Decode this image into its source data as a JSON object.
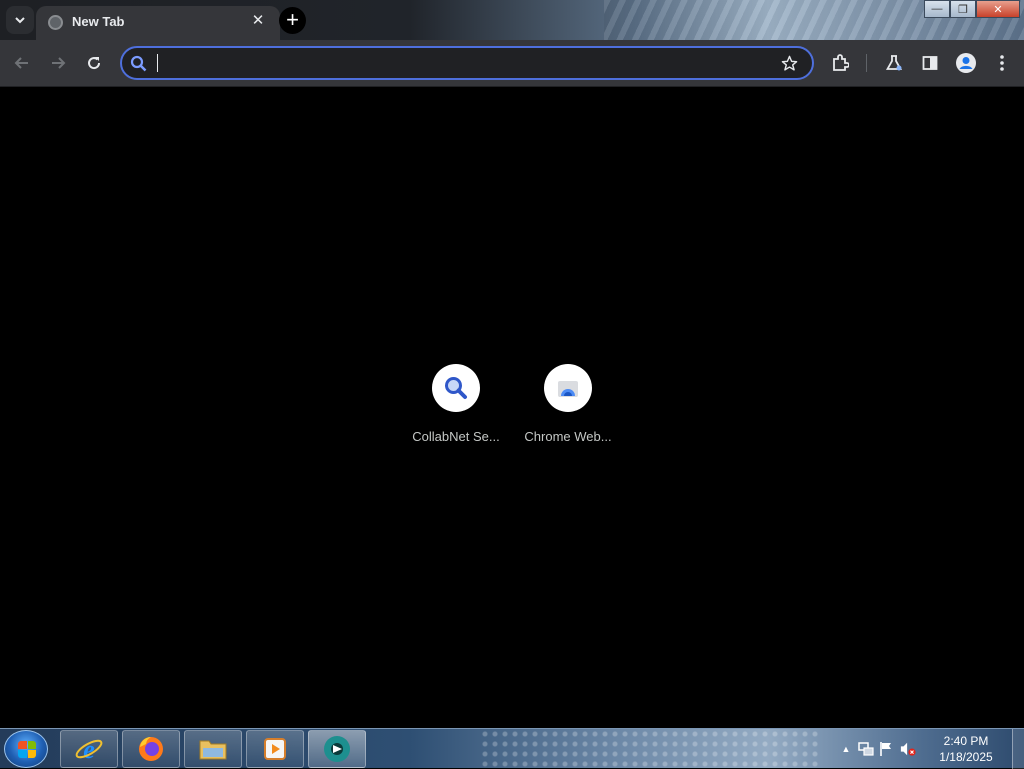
{
  "browser": {
    "tab": {
      "title": "New Tab",
      "close_glyph": "✕"
    },
    "new_tab_glyph": "+",
    "omnibox": {
      "value": "",
      "placeholder": ""
    },
    "window_controls": {
      "minimize": "—",
      "maximize": "❐",
      "close": "✕"
    }
  },
  "new_tab_page": {
    "shortcuts": [
      {
        "label": "CollabNet Se...",
        "icon": "search-icon"
      },
      {
        "label": "Chrome Web...",
        "icon": "chrome-web-store-icon"
      }
    ]
  },
  "taskbar": {
    "apps": [
      {
        "name": "internet-explorer"
      },
      {
        "name": "firefox"
      },
      {
        "name": "file-explorer"
      },
      {
        "name": "media-player"
      },
      {
        "name": "chrome-beta",
        "active": true
      }
    ],
    "tray": {
      "overflow_glyph": "▲"
    },
    "clock": {
      "time": "2:40 PM",
      "date": "1/18/2025"
    }
  },
  "colors": {
    "accent": "#4e6fdc",
    "toolbar": "#35363a",
    "page_bg": "#000000"
  }
}
